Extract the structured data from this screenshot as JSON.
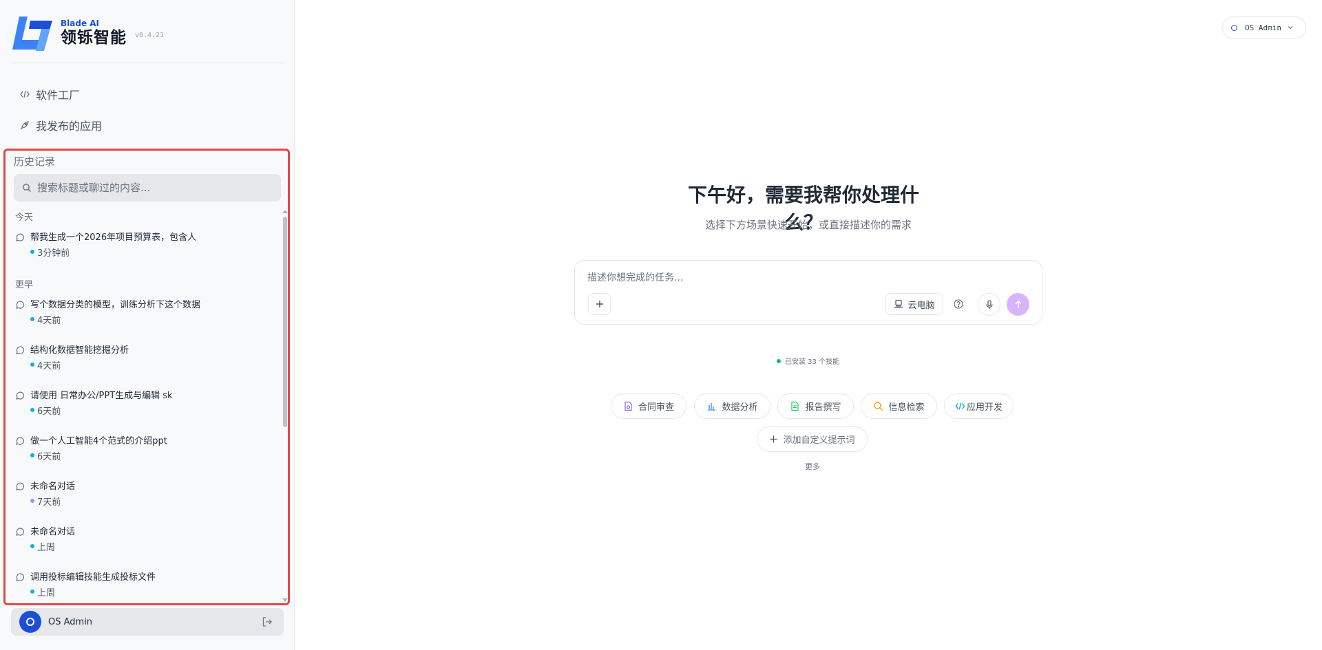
{
  "brand": {
    "small": "Blade AI",
    "name": "领铄智能",
    "version": "v0.4.21"
  },
  "nav": {
    "software_factory": "软件工厂",
    "my_apps": "我发布的应用"
  },
  "history": {
    "title": "历史记录",
    "search_placeholder": "搜索标题或聊过的内容...",
    "groups": {
      "today": "今天",
      "earlier": "更早"
    },
    "items": [
      {
        "title": "帮我生成一个2026年项目预算表，包含人",
        "time": "3分钟前",
        "dot_color": "#06b6d4"
      },
      {
        "title": "写个数据分类的模型，训练分析下这个数据",
        "time": "4天前",
        "dot_color": "#06b6d4"
      },
      {
        "title": "结构化数据智能挖掘分析",
        "time": "4天前",
        "dot_color": "#06b6d4"
      },
      {
        "title": "请使用 日常办公/PPT生成与编辑 sk",
        "time": "6天前",
        "dot_color": "#06b6d4"
      },
      {
        "title": "做一个人工智能4个范式的介绍ppt",
        "time": "6天前",
        "dot_color": "#06b6d4"
      },
      {
        "title": "未命名对话",
        "time": "7天前",
        "dot_color": "#a78bfa"
      },
      {
        "title": "未命名对话",
        "time": "上周",
        "dot_color": "#06b6d4"
      },
      {
        "title": "调用投标编辑技能生成投标文件",
        "time": "上周",
        "dot_color": "#06b6d4"
      }
    ]
  },
  "user": {
    "name": "OS Admin"
  },
  "header": {
    "user_name": "OS Admin"
  },
  "main": {
    "greeting": "下午好，需要我帮你处理什么？",
    "subtitle": "选择下方场景快速开始，或直接描述你的需求",
    "input_placeholder": "描述你想完成的任务...",
    "cloud_pc": "云电脑",
    "skills_text": "已安装 33 个技能",
    "chips": [
      {
        "label": "合同审查",
        "icon": "contract-icon",
        "color": "#8b5cf6"
      },
      {
        "label": "数据分析",
        "icon": "chart-icon",
        "color": "#3b82f6"
      },
      {
        "label": "报告撰写",
        "icon": "document-icon",
        "color": "#22c55e"
      },
      {
        "label": "信息检索",
        "icon": "search-icon",
        "color": "#f59e0b"
      },
      {
        "label": "应用开发",
        "icon": "code-icon",
        "color": "#06b6d4"
      }
    ],
    "add_prompt": "添加自定义提示词",
    "more": "更多"
  },
  "colors": {
    "accent": "#1d4ed8",
    "send": "#d8b4fe",
    "highlight_border": "#e04848"
  }
}
